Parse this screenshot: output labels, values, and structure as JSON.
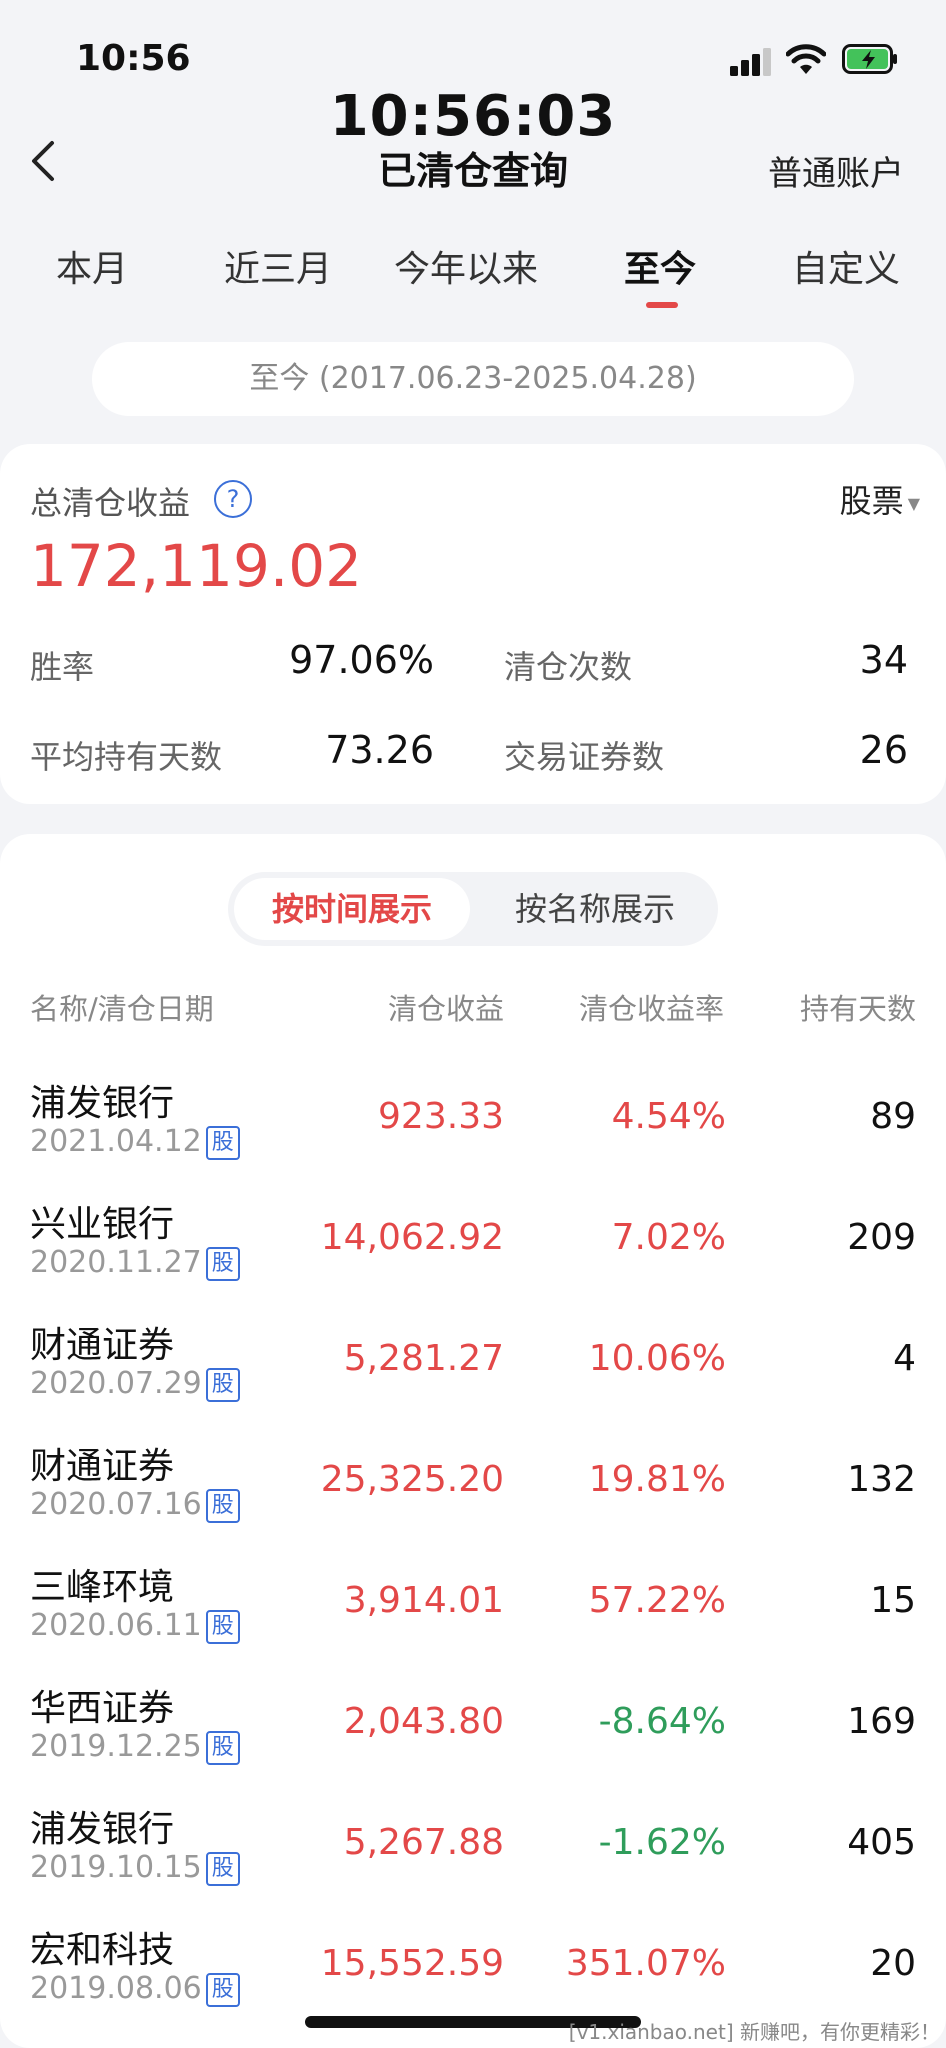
{
  "status_bar": {
    "time": "10:56"
  },
  "header": {
    "clock": "10:56:03",
    "title": "已清仓查询",
    "account_label": "普通账户"
  },
  "tabs": [
    {
      "label": "本月",
      "active": false
    },
    {
      "label": "近三月",
      "active": false
    },
    {
      "label": "今年以来",
      "active": false
    },
    {
      "label": "至今",
      "active": true
    },
    {
      "label": "自定义",
      "active": false
    }
  ],
  "date_range": "至今 (2017.06.23-2025.04.28)",
  "summary": {
    "total_label": "总清仓收益",
    "total_value": "172,119.02",
    "type_select": "股票",
    "stats": [
      {
        "label": "胜率",
        "value": "97.06%"
      },
      {
        "label": "清仓次数",
        "value": "34"
      },
      {
        "label": "平均持有天数",
        "value": "73.26"
      },
      {
        "label": "交易证券数",
        "value": "26"
      }
    ]
  },
  "view_toggle": {
    "by_time": "按时间展示",
    "by_name": "按名称展示"
  },
  "table": {
    "columns": [
      "名称/清仓日期",
      "清仓收益",
      "清仓收益率",
      "持有天数"
    ],
    "badge": "股",
    "rows": [
      {
        "name": "浦发银行",
        "date": "2021.04.12",
        "profit": "923.33",
        "rate": "4.54%",
        "days": "89",
        "rate_color": "red"
      },
      {
        "name": "兴业银行",
        "date": "2020.11.27",
        "profit": "14,062.92",
        "rate": "7.02%",
        "days": "209",
        "rate_color": "red"
      },
      {
        "name": "财通证券",
        "date": "2020.07.29",
        "profit": "5,281.27",
        "rate": "10.06%",
        "days": "4",
        "rate_color": "red"
      },
      {
        "name": "财通证券",
        "date": "2020.07.16",
        "profit": "25,325.20",
        "rate": "19.81%",
        "days": "132",
        "rate_color": "red"
      },
      {
        "name": "三峰环境",
        "date": "2020.06.11",
        "profit": "3,914.01",
        "rate": "57.22%",
        "days": "15",
        "rate_color": "red"
      },
      {
        "name": "华西证券",
        "date": "2019.12.25",
        "profit": "2,043.80",
        "rate": "-8.64%",
        "days": "169",
        "rate_color": "green"
      },
      {
        "name": "浦发银行",
        "date": "2019.10.15",
        "profit": "5,267.88",
        "rate": "-1.62%",
        "days": "405",
        "rate_color": "green"
      },
      {
        "name": "宏和科技",
        "date": "2019.08.06",
        "profit": "15,552.59",
        "rate": "351.07%",
        "days": "20",
        "rate_color": "red"
      }
    ]
  },
  "watermark": "[v1.xianbao.net] 新赚吧，有你更精彩！",
  "colors": {
    "accent_red": "#e34848",
    "loss_green": "#2f9d5b",
    "link_blue": "#3b6fd8"
  }
}
